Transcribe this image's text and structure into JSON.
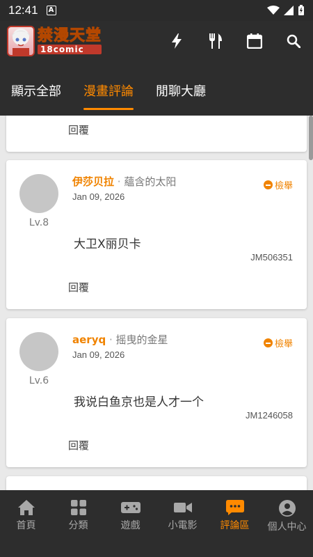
{
  "status_bar": {
    "time": "12:41",
    "indicator": "A"
  },
  "app": {
    "logo_title": "禁漫天堂",
    "logo_subtitle": "18comic",
    "actions": [
      "lightning-icon",
      "utensils-icon",
      "calendar-icon",
      "search-icon"
    ]
  },
  "tabs": [
    {
      "label": "顯示全部",
      "active": false
    },
    {
      "label": "漫畫評論",
      "active": true
    },
    {
      "label": "閒聊大廳",
      "active": false
    }
  ],
  "partial_card": {
    "reply_label": "回覆"
  },
  "comments": [
    {
      "username": "伊莎贝拉",
      "separator": " · ",
      "tagline": "蘊含的太阳",
      "date": "Jan 09, 2026",
      "level": "Lv.8",
      "report_label": "檢舉",
      "text": "大卫X丽贝卡",
      "code": "JM506351",
      "reply_label": "回覆"
    },
    {
      "username": "aeryq",
      "separator": " · ",
      "tagline": "摇曳的金星",
      "date": "Jan 09, 2026",
      "level": "Lv.6",
      "report_label": "檢舉",
      "text": "我说白鱼京也是人才一个",
      "code": "JM1246058",
      "reply_label": "回覆"
    }
  ],
  "bottom_nav": [
    {
      "label": "首頁",
      "icon": "home-icon",
      "active": false
    },
    {
      "label": "分類",
      "icon": "grid-icon",
      "active": false
    },
    {
      "label": "遊戲",
      "icon": "gamepad-icon",
      "active": false
    },
    {
      "label": "小電影",
      "icon": "video-camera-icon",
      "active": false
    },
    {
      "label": "評論區",
      "icon": "comment-icon",
      "active": true
    },
    {
      "label": "個人中心",
      "icon": "user-icon",
      "active": false
    }
  ],
  "colors": {
    "accent": "#ff8a00",
    "bar_bg": "#2d2d2d",
    "page_bg": "#e9e9e9"
  }
}
